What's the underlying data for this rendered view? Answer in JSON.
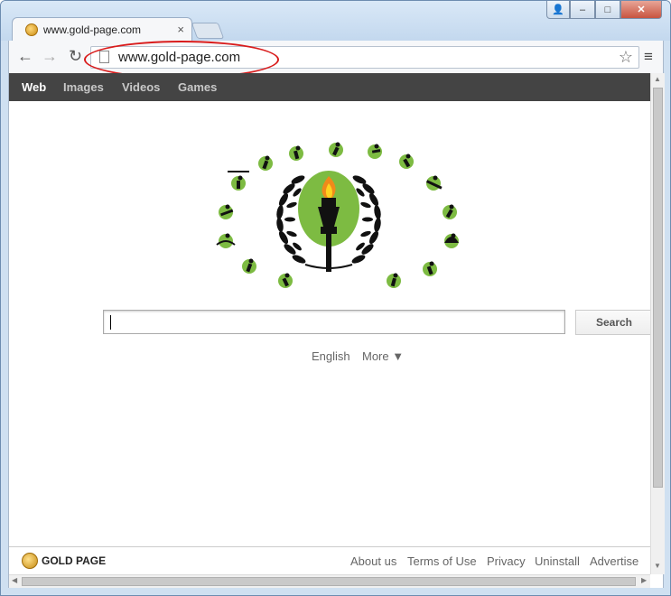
{
  "browser": {
    "tab_title": "www.gold-page.com",
    "tab_close": "×",
    "url": "www.gold-page.com",
    "window_controls": {
      "user": "👤",
      "minimize": "–",
      "maximize": "□",
      "close": "✕"
    },
    "nav": {
      "back": "←",
      "forward": "→",
      "reload": "↻",
      "star": "☆",
      "menu": "≡"
    }
  },
  "site": {
    "nav": {
      "web": "Web",
      "images": "Images",
      "videos": "Videos",
      "games": "Games"
    },
    "search": {
      "value": "",
      "button": "Search"
    },
    "languages": {
      "english": "English",
      "more": "More ▼"
    },
    "footer": {
      "brand": "GOLD PAGE",
      "links": {
        "about": "About us",
        "terms": "Terms of Use",
        "privacy": "Privacy",
        "uninstall": "Uninstall",
        "advertise": "Advertise"
      }
    }
  },
  "colors": {
    "nav_bg": "#444444",
    "logo_green": "#7dbb42",
    "highlight_red": "#d91c1c",
    "flame": "#f08a1a"
  },
  "icons": {
    "logo": "olympic-torch-with-laurel-and-sport-pictograms"
  }
}
